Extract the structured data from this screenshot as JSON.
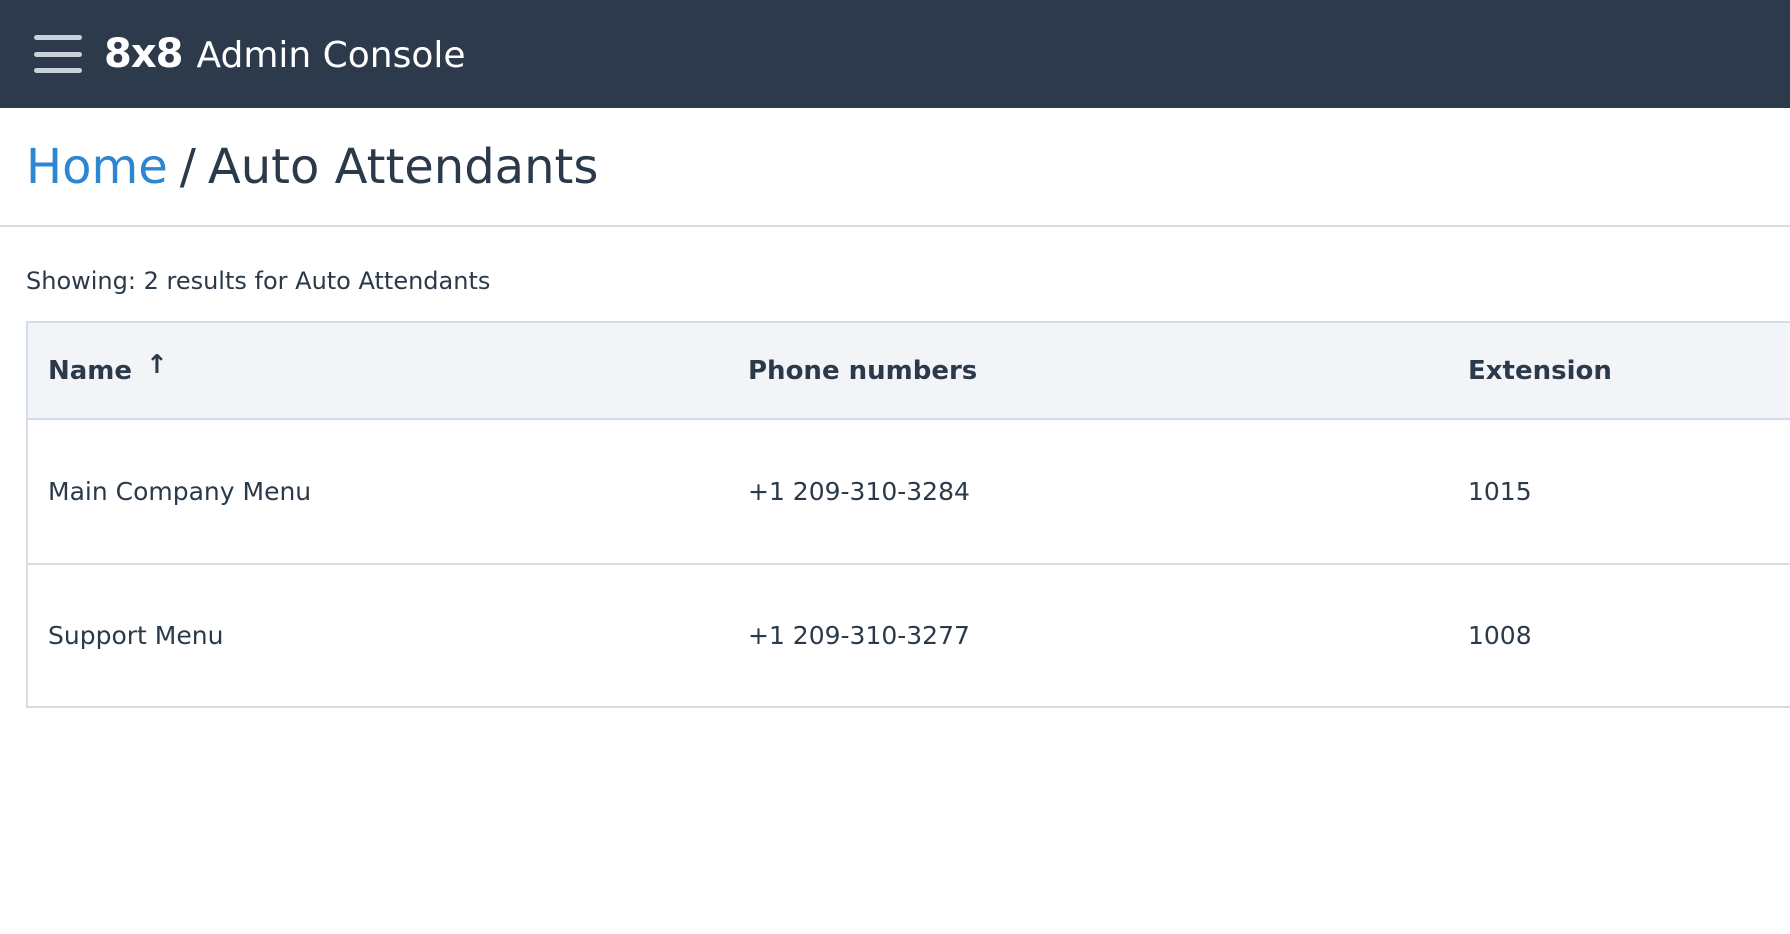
{
  "header": {
    "logo": "8x8",
    "title": "Admin Console"
  },
  "breadcrumb": {
    "home": "Home",
    "separator": "/",
    "current": "Auto Attendants"
  },
  "results_text": "Showing: 2 results for Auto Attendants",
  "table": {
    "columns": {
      "name": "Name",
      "phone": "Phone numbers",
      "extension": "Extension"
    },
    "sort_indicator": "↑",
    "rows": [
      {
        "name": "Main Company Menu",
        "phone": "+1 209-310-3284",
        "extension": "1015"
      },
      {
        "name": "Support Menu",
        "phone": "+1 209-310-3277",
        "extension": "1008"
      }
    ]
  },
  "colors": {
    "topbar": "#2c3a4b",
    "link": "#2d86d1",
    "text": "#2b3a4a",
    "border": "#d3dde6",
    "table_header_bg": "#f2f4f7"
  },
  "icons": {
    "menu": "hamburger-menu-icon",
    "sort": "arrow-up-icon"
  }
}
